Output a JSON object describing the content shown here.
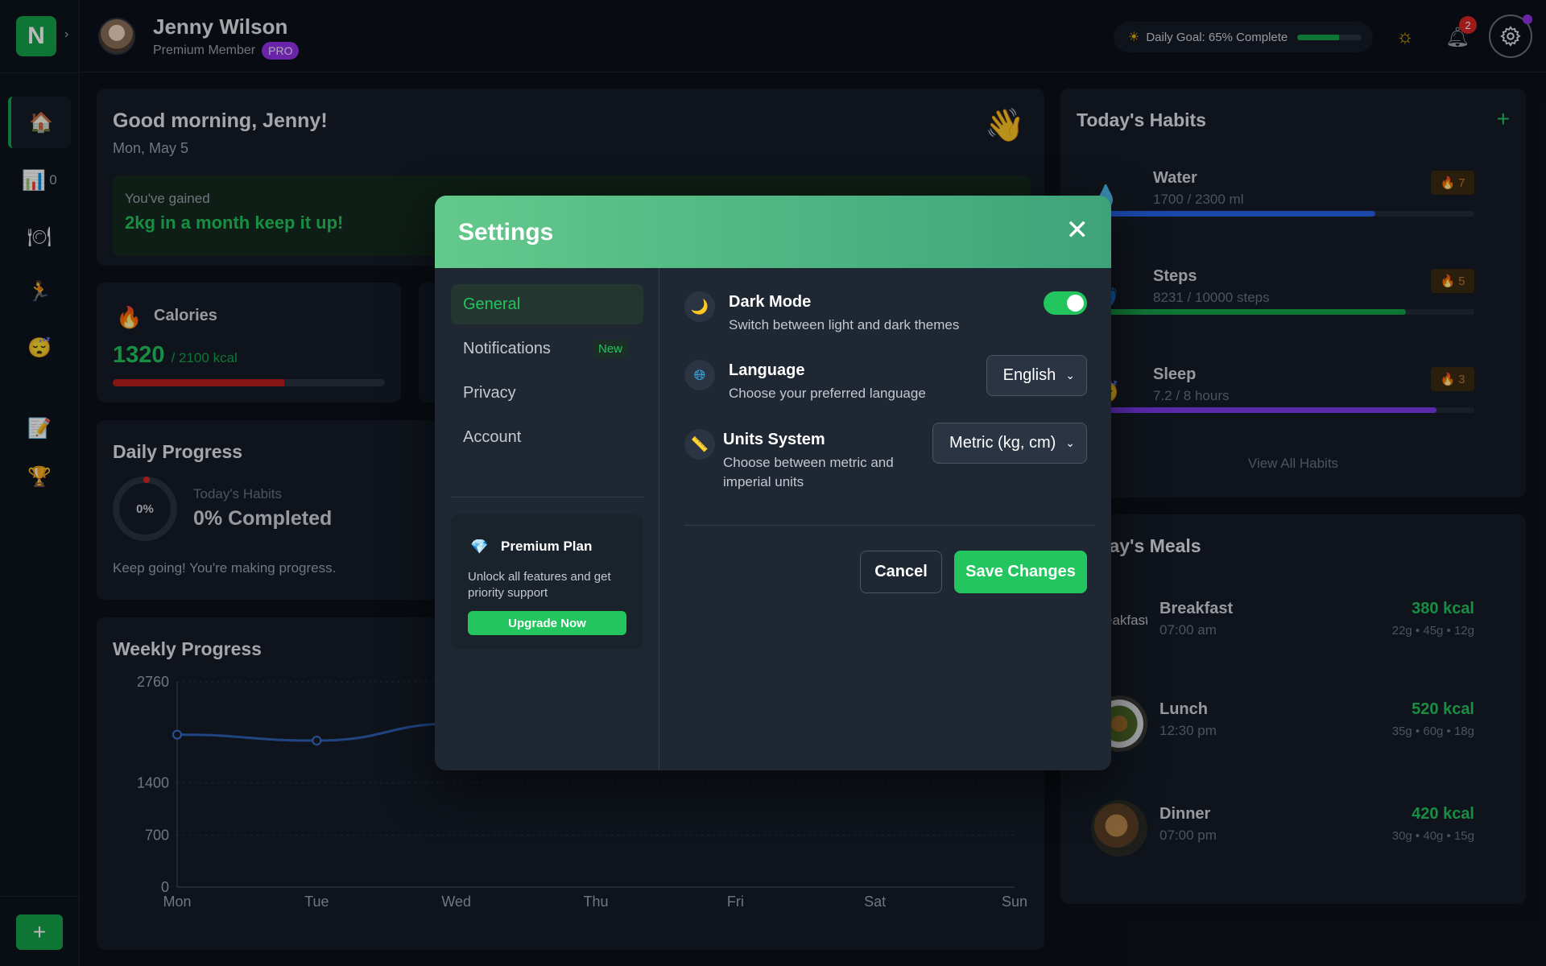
{
  "app": {
    "logo_letter": "N",
    "expand": "›"
  },
  "sidebar": {
    "items": [
      {
        "icon": "🏠",
        "name": "home",
        "count": ""
      },
      {
        "icon": "📊",
        "name": "stats",
        "count": "0"
      },
      {
        "icon": "🍽",
        "name": "meals",
        "count": ""
      },
      {
        "icon": "🏃",
        "name": "activity",
        "count": ""
      },
      {
        "icon": "😴",
        "name": "sleep",
        "count": ""
      },
      {
        "icon": "📝",
        "name": "notes",
        "count": ""
      },
      {
        "icon": "🏆",
        "name": "achievements",
        "count": ""
      }
    ],
    "add_label": "+"
  },
  "header": {
    "user_name": "Jenny Wilson",
    "membership": "Premium Member",
    "badge": "PRO",
    "daily_goal_text": "Daily Goal: 65% Complete",
    "daily_goal_fraction": 0.65,
    "notification_count": "2"
  },
  "greeting": {
    "title": "Good morning, Jenny!",
    "date": "Mon, May 5",
    "gain_label": "You've gained",
    "gain_value": "2kg in a month keep it up!"
  },
  "calories": {
    "title": "Calories",
    "value": "1320",
    "target": "/ 2100 kcal",
    "fraction": 0.63
  },
  "daily_progress": {
    "title": "Daily Progress",
    "ring_label": "0%",
    "label": "Today's Habits",
    "value": "0% Completed",
    "note": "Keep going! You're making progress."
  },
  "weekly_progress": {
    "title": "Weekly Progress"
  },
  "chart_data": {
    "type": "line",
    "title": "Weekly Progress",
    "categories": [
      "Mon",
      "Tue",
      "Wed",
      "Thu",
      "Fri",
      "Sat",
      "Sun"
    ],
    "series": [
      {
        "values": [
          2050,
          1970,
          2200
        ]
      }
    ],
    "yticks": [
      "0",
      "700",
      "1400",
      "2760"
    ],
    "ytick_values": [
      0,
      700,
      1400,
      2760
    ],
    "ylim": [
      0,
      2760
    ],
    "grid": true
  },
  "habits": {
    "title": "Today's Habits",
    "add": "+",
    "items": [
      {
        "icon": "💧",
        "name": "Water",
        "sub": "1700 / 2300 ml",
        "streak": "7",
        "fraction": 0.74,
        "color": "#2563eb"
      },
      {
        "icon": "👣",
        "name": "Steps",
        "sub": "8231 / 10000 steps",
        "streak": "5",
        "fraction": 0.82,
        "color": "#16a34a"
      },
      {
        "icon": "😴",
        "name": "Sleep",
        "sub": "7.2 / 8 hours",
        "streak": "3",
        "fraction": 0.9,
        "color": "#7c3aed"
      }
    ],
    "view_all": "View All Habits"
  },
  "meals": {
    "title": "Today's Meals",
    "items": [
      {
        "name": "Breakfast",
        "time": "07:00 am",
        "kcal": "380 kcal",
        "macros": "22g • 45g • 12g",
        "img_alt": "Breakfast"
      },
      {
        "name": "Lunch",
        "time": "12:30 pm",
        "kcal": "520 kcal",
        "macros": "35g • 60g • 18g",
        "img_alt": ""
      },
      {
        "name": "Dinner",
        "time": "07:00 pm",
        "kcal": "420 kcal",
        "macros": "30g • 40g • 15g",
        "img_alt": ""
      }
    ]
  },
  "settings": {
    "title": "Settings",
    "tabs": [
      {
        "label": "General",
        "active": true
      },
      {
        "label": "Notifications",
        "badge": "New"
      },
      {
        "label": "Privacy"
      },
      {
        "label": "Account"
      }
    ],
    "premium": {
      "title": "Premium Plan",
      "desc": "Unlock all features and get priority support",
      "button": "Upgrade Now"
    },
    "dark_mode": {
      "title": "Dark Mode",
      "desc": "Switch between light and dark themes",
      "enabled": true
    },
    "language": {
      "title": "Language",
      "desc": "Choose your preferred language",
      "value": "English"
    },
    "units": {
      "title": "Units System",
      "desc": "Choose between metric and imperial units",
      "value": "Metric (kg, cm)"
    },
    "cancel": "Cancel",
    "save": "Save Changes"
  }
}
